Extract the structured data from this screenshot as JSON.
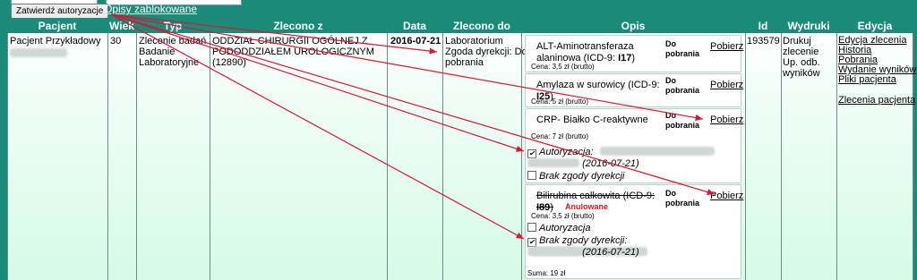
{
  "topbar": {
    "button": "Zatwierdź autoryzacje",
    "locked_link": "Opisy zablokowane"
  },
  "headers": {
    "pacjent": "Pacjent",
    "wiek": "Wiek",
    "typ": "Typ",
    "zlecono_z": "Zlecono z",
    "data": "Data",
    "zlecono_do": "Zlecono do",
    "opis": "Opis",
    "id": "Id",
    "wydruki": "Wydruki",
    "edycja": "Edycja"
  },
  "row": {
    "pacjent": "Pacjent Przykładowy",
    "wiek": "30",
    "typ": [
      "Zlecenie badań",
      "Badanie",
      "Laboratoryjne"
    ],
    "zlecono_z": [
      "ODDZIAŁ CHIRURGII OGÓLNEJ Z",
      "PODODDZIAŁEM UROLOGICZNYM",
      "(12890)"
    ],
    "data": "2016-07-21",
    "zlecono_do": [
      "Laboratorium",
      "Zgoda dyrekcji: Do",
      "pobrania"
    ],
    "id": "193579",
    "wydruki": [
      "Drukuj",
      "zlecenie",
      "Up. odb.",
      "wyników"
    ],
    "edycja": [
      "Edycja zlecenia",
      "Historia",
      "Pobrania",
      "Wydanie wyników",
      "Pliki pacjenta",
      "Zlecenia pacjenta"
    ]
  },
  "tests": [
    {
      "name": "ALT-Aminotransferaza alaninowa (ICD-9:",
      "code": "I17",
      "price": "Cena: 3,5 zł (brutto)",
      "status_line1": "Do",
      "status_line2": "pobrania",
      "link": "Pobierz"
    },
    {
      "name": "Amylaza w surowicy (ICD-9:",
      "code": "I25",
      "price": "Cena: 5 zł (brutto)",
      "status_line1": "Do",
      "status_line2": "pobrania",
      "link": "Pobierz"
    },
    {
      "name": "CRP- Białko C-reaktywne",
      "code": "",
      "price": "Cena: 7 zł (brutto)",
      "status_line1": "Do",
      "status_line2": "pobrania",
      "link": "Pobierz",
      "autoryzacja_label": "Autoryzacja:",
      "autoryzacja_date": "(2016-07-21)",
      "autoryzacja_checked": true,
      "brak_label": "Brak zgody dyrekcji",
      "brak_checked": false
    },
    {
      "name": "Bilirubina całkowita (ICD-9:",
      "code": "I89",
      "cancelled": "Anulowane",
      "price": "Cena: 3,5 zł (brutto)",
      "status_line1": "Do",
      "status_line2": "pobrania",
      "link": "Pobierz",
      "autoryzacja_label": "Autoryzacja",
      "autoryzacja_checked": false,
      "brak_label": "Brak zgody dyrekcji:",
      "brak_date": "(2016-07-21)",
      "brak_checked": true
    }
  ],
  "suma": "Suma: 19 zł",
  "colors": {
    "header_bg": "#1c8a78",
    "arrow": "#d11a35",
    "cancelled": "#cc1a1a"
  }
}
